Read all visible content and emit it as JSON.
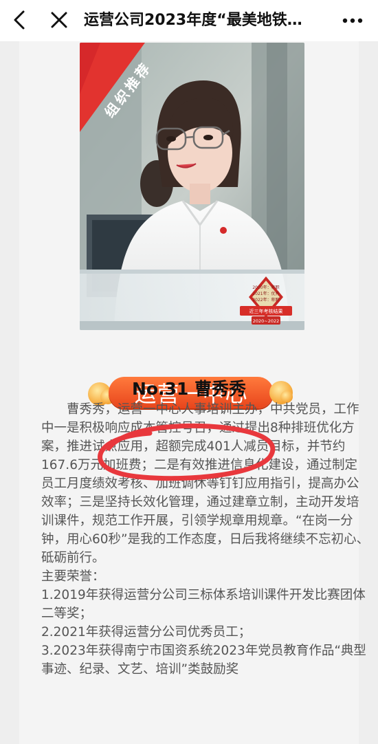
{
  "nav": {
    "title": "运营公司2023年度“最美地铁…",
    "back_icon": "chevron-left-icon",
    "close_icon": "close-icon",
    "more_icon": "more-icon"
  },
  "photo": {
    "ribbon_text": "组织推荐",
    "badge": {
      "year_lines": [
        "2020年：称职",
        "2021年：优秀",
        "2022年：称职"
      ],
      "ribbon": "近三年考核结果",
      "range": "2020~2022"
    }
  },
  "department": "运营一中心",
  "person": {
    "heading": "No.31 曹秀秀"
  },
  "bio": {
    "paragraph": "曹秀秀，运营一中心人事培训主办，中共党员，工作中一是积极响应成本管控号召，通过提出8种排班优化方案，推进试点应用，超额完成401人减员目标，并节约167.6万元加班费；二是有效推进信息化建设，通过制定员工月度绩效考核、加班调休等钉钉应用指引，提高办公效率；三是坚持长效化管理，通过建章立制，主动开发培训课件，规范工作开展，引领学规章用规章。“在岗一分钟，用心60秒”是我的工作态度，日后我将继续不忘初心、砥砺前行。",
    "honors_title": "主要荣誉：",
    "honors": [
      "1.2019年获得运营分公司三标体系培训课件开发比赛团体二等奖；",
      "2.2021年获得运营分公司优秀员工；",
      "3.2023年获得南宁市国资系统2023年党员教育作品“典型事迹、纪录、文艺、培训”类鼓励奖"
    ]
  },
  "colors": {
    "accent": "#e8451c",
    "annotation": "#e8383d"
  }
}
